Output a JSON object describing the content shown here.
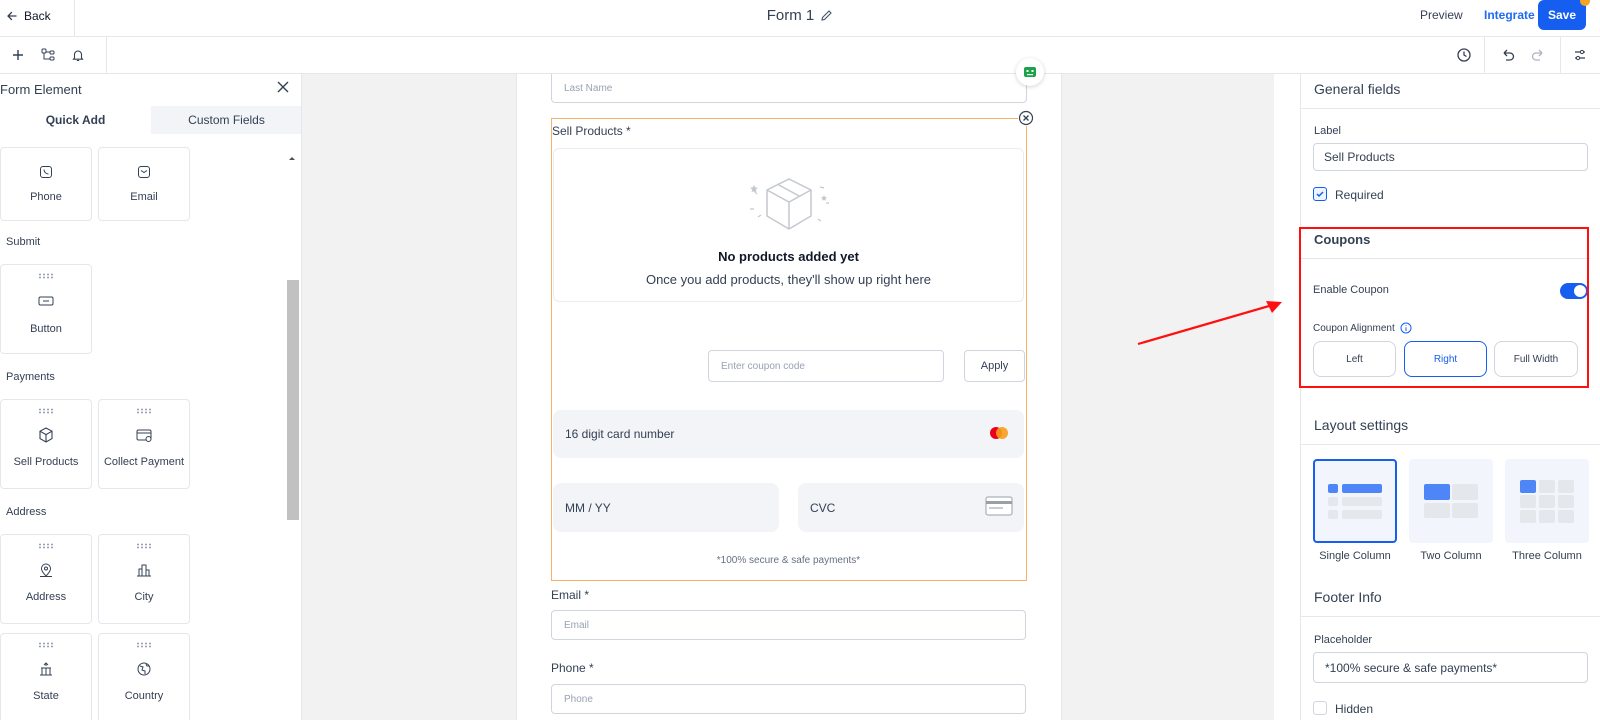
{
  "header": {
    "back_label": "Back",
    "form_title": "Form 1",
    "preview_label": "Preview",
    "integrate_label": "Integrate",
    "save_label": "Save"
  },
  "toolbar": {
    "left_icons": [
      "plus-icon",
      "structure-icon",
      "bell-icon"
    ],
    "right_icons": [
      "history-icon",
      "undo-icon",
      "redo-icon",
      "settings-sliders-icon"
    ]
  },
  "left_panel": {
    "title": "Form Element",
    "tabs": [
      {
        "label": "Quick Add",
        "active": true
      },
      {
        "label": "Custom Fields",
        "active": false
      }
    ],
    "top_cards": [
      {
        "label": "Phone",
        "icon": "phone-icon"
      },
      {
        "label": "Email",
        "icon": "mail-icon"
      }
    ],
    "sections": [
      {
        "title": "Submit",
        "items": [
          {
            "label": "Button",
            "icon": "button-icon"
          }
        ]
      },
      {
        "title": "Payments",
        "items": [
          {
            "label": "Sell Products",
            "icon": "box-icon"
          },
          {
            "label": "Collect Payment",
            "icon": "payment-card-icon"
          }
        ]
      },
      {
        "title": "Address",
        "items": [
          {
            "label": "Address",
            "icon": "map-pin-icon"
          },
          {
            "label": "City",
            "icon": "city-icon"
          },
          {
            "label": "State",
            "icon": "state-icon"
          },
          {
            "label": "Country",
            "icon": "globe-icon"
          }
        ]
      }
    ]
  },
  "canvas": {
    "last_name_placeholder": "Last Name",
    "sell_products_label": "Sell Products *",
    "empty_title": "No products added yet",
    "empty_subtitle": "Once you add products, they'll show up right here",
    "coupon_placeholder": "Enter coupon code",
    "apply_label": "Apply",
    "card_number_placeholder": "16 digit card number",
    "expiry_placeholder": "MM / YY",
    "cvc_placeholder": "CVC",
    "secure_note": "*100% secure & safe payments*",
    "email_label": "Email *",
    "email_placeholder": "Email",
    "phone_label": "Phone *",
    "phone_placeholder": "Phone"
  },
  "right_panel": {
    "general_title": "General fields",
    "label_caption": "Label",
    "label_value": "Sell Products",
    "required_label": "Required",
    "required_checked": true,
    "coupons_title": "Coupons",
    "enable_coupon_label": "Enable Coupon",
    "enable_coupon_on": true,
    "coupon_alignment_label": "Coupon Alignment",
    "alignment_options": [
      "Left",
      "Right",
      "Full Width"
    ],
    "alignment_selected": "Right",
    "layout_title": "Layout settings",
    "layout_options": [
      "Single Column",
      "Two Column",
      "Three Column"
    ],
    "layout_selected": "Single Column",
    "footer_title": "Footer Info",
    "placeholder_caption": "Placeholder",
    "placeholder_value": "*100% secure & safe payments*",
    "hidden_label": "Hidden",
    "hidden_checked": false
  },
  "colors": {
    "accent": "#155eef",
    "annotation": "#ff1010",
    "selected_outline": "#f7b267"
  }
}
